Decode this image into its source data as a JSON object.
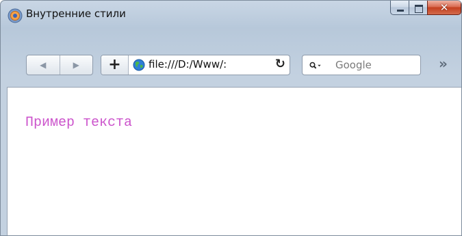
{
  "window": {
    "title": "Внутренние стили"
  },
  "toolbar": {
    "back_icon": "back-arrow-icon",
    "forward_icon": "forward-arrow-icon",
    "add_label": "+",
    "address": "file:///D:/Www/:",
    "search_placeholder": "Google",
    "overflow_label": "»"
  },
  "content": {
    "text": "Пример текста",
    "text_color": "#cc55cc"
  }
}
